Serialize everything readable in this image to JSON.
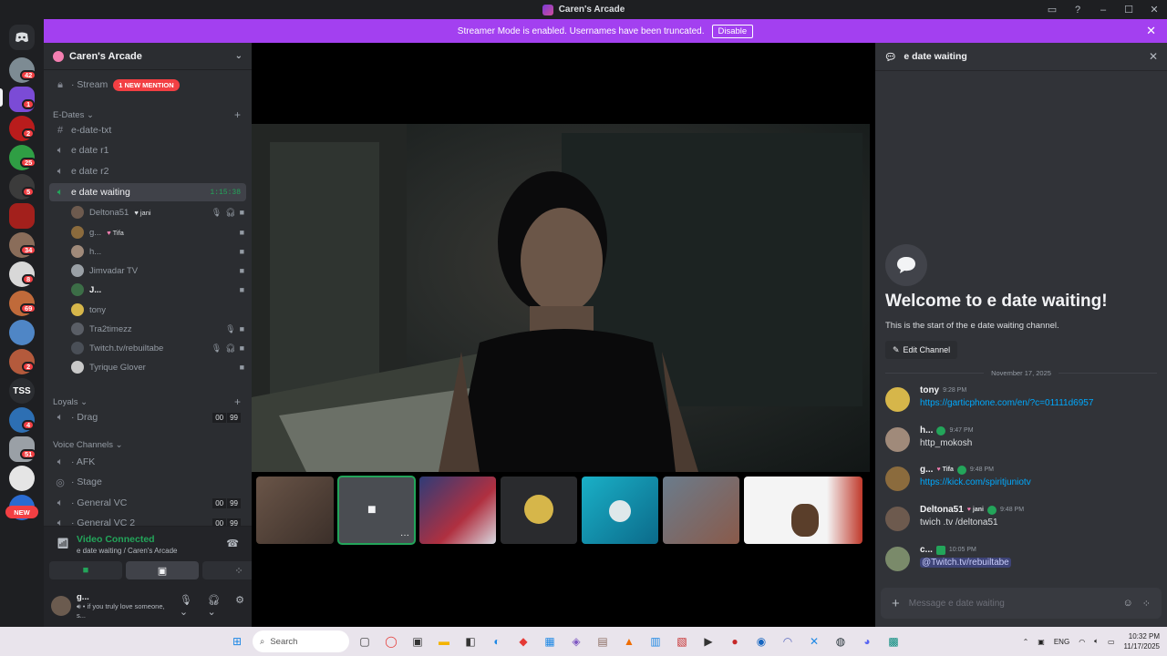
{
  "window": {
    "title": "Caren's Arcade"
  },
  "banner": {
    "text": "Streamer Mode is enabled. Usernames have been truncated.",
    "button": "Disable"
  },
  "rail": {
    "badges": [
      "42",
      "1",
      "2",
      "25",
      "5",
      "34",
      "8",
      "69",
      "2",
      "4",
      "51"
    ],
    "tss_label": "TSS",
    "new_label": "NEW"
  },
  "server": {
    "name": "Caren's Arcade",
    "stream_channel": "Stream",
    "mention_badge": "1 NEW MENTION",
    "categories": {
      "edates": "E-Dates",
      "loyals": "Loyals",
      "voice": "Voice Channels"
    },
    "edates_channels": [
      "e-date-txt",
      "e date r1",
      "e date r2"
    ],
    "active_channel": "e date waiting",
    "active_timer": "1:15:38",
    "voice_users": [
      {
        "name": "Deltona51",
        "tag": "jani",
        "color": "#6d5a4e"
      },
      {
        "name": "g...",
        "tag": "Tifa",
        "color": "#8b6b3d"
      },
      {
        "name": "h...",
        "tag": "",
        "color": "#a08a7a"
      },
      {
        "name": "Jimvadar TV",
        "tag": "",
        "color": "#9aa0a6"
      },
      {
        "name": "J...",
        "tag": "",
        "color": "#3c6e47"
      },
      {
        "name": "tony",
        "tag": "",
        "color": "#d6b64a"
      },
      {
        "name": "Tra2timezz",
        "tag": "",
        "color": "#5a5e66"
      },
      {
        "name": "Twitch.tv/rebuiltabe",
        "tag": "",
        "color": "#4a4f57"
      },
      {
        "name": "Tyrique Glover",
        "tag": "",
        "color": "#c9c9c9"
      }
    ],
    "loyals_channels": [
      {
        "name": "Drag",
        "count_a": "00",
        "count_b": "99"
      }
    ],
    "voice_channels": [
      {
        "name": "AFK",
        "count_a": "",
        "count_b": ""
      },
      {
        "name": "Stage",
        "count_a": "",
        "count_b": ""
      },
      {
        "name": "General VC",
        "count_a": "00",
        "count_b": "99"
      },
      {
        "name": "General VC 2",
        "count_a": "00",
        "count_b": "99"
      }
    ]
  },
  "voice_panel": {
    "status": "Video Connected",
    "location": "e date waiting / Caren's Arcade"
  },
  "user": {
    "name": "g...",
    "status": "if you truly love someone, s..."
  },
  "chat": {
    "channel": "e date waiting",
    "welcome_title": "Welcome to e date waiting!",
    "welcome_sub": "This is the start of the e date waiting channel.",
    "edit_button": "Edit Channel",
    "date": "November 17, 2025",
    "messages": [
      {
        "author": "tony",
        "tag": "",
        "time": "9:28 PM",
        "text": "https://garticphone.com/en/?c=01111d6957",
        "kind": "link",
        "color": "#d6b64a"
      },
      {
        "author": "h...",
        "tag": "",
        "time": "9:47 PM",
        "text": "http_mokosh",
        "kind": "plain",
        "color": "#a08a7a"
      },
      {
        "author": "g...",
        "tag": "Tifa",
        "time": "9:48 PM",
        "text": "https://kick.com/spiritjuniotv",
        "kind": "link",
        "color": "#8b6b3d"
      },
      {
        "author": "Deltona51",
        "tag": "jani",
        "time": "9:48 PM",
        "text": "twich .tv /deltona51",
        "kind": "plain",
        "color": "#6d5a4e"
      },
      {
        "author": "c...",
        "tag": "",
        "time": "10:05 PM",
        "text": "@Twitch.tv/rebuiltabe",
        "kind": "mention",
        "color": "#7a8a6a"
      }
    ],
    "composer_placeholder": "Message e date waiting"
  },
  "taskbar": {
    "search": "Search",
    "lang": "ENG",
    "time": "10:32 PM",
    "date": "11/17/2025"
  }
}
